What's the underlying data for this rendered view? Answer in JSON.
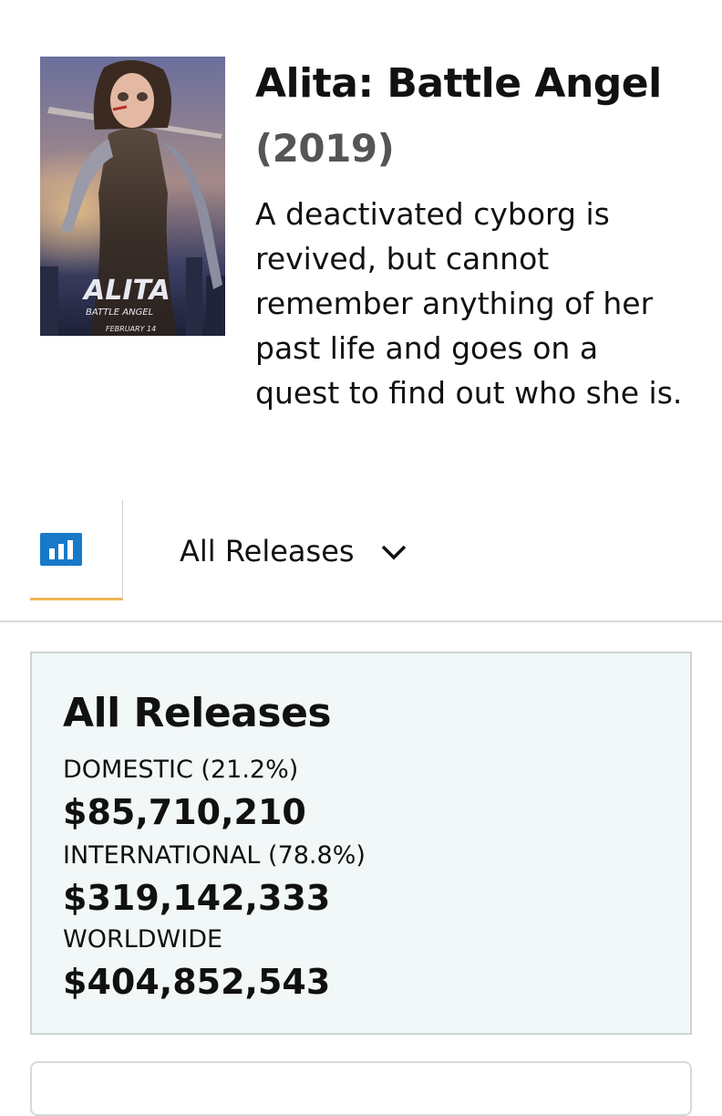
{
  "movie": {
    "title": "Alita: Battle Angel",
    "year": "(2019)",
    "plot": "A deactivated cyborg is revived, but cannot remember anything of her past life and goes on a quest to find out who she is.",
    "poster": {
      "logo_text": "ALITA",
      "subtitle_text": "BATTLE ANGEL",
      "date_text": "FEBRUARY 14"
    }
  },
  "tabs": {
    "chart_icon": "bar-chart-icon",
    "release_filter": "All Releases",
    "dropdown_icon": "chevron-down-icon"
  },
  "summary": {
    "title": "All Releases",
    "domestic_label": "DOMESTIC (21.2%)",
    "domestic_value": "$85,710,210",
    "international_label": "INTERNATIONAL (78.8%)",
    "international_value": "$319,142,333",
    "worldwide_label": "WORLDWIDE",
    "worldwide_value": "$404,852,543"
  },
  "colors": {
    "accent_underline": "#f0b654",
    "icon_blue": "#1779c8",
    "summary_bg": "#f2f7f7"
  }
}
